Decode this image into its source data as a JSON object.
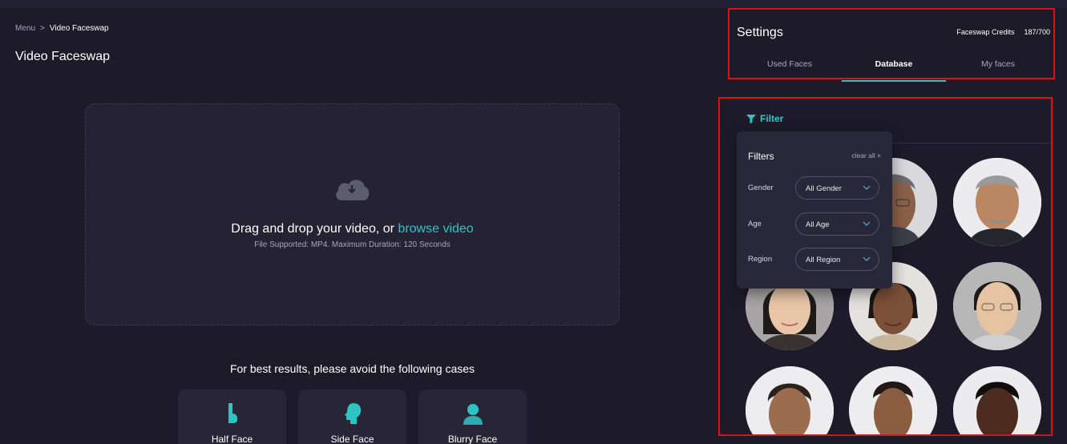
{
  "breadcrumb": {
    "root": "Menu",
    "separator": ">",
    "current": "Video Faceswap"
  },
  "page_title": "Video Faceswap",
  "upload": {
    "text_prefix": "Drag and drop your video, or ",
    "link_text": "browse video",
    "sub_text": "File Supported: MP4. Maximum Duration: 120 Seconds"
  },
  "avoid": {
    "title": "For best results, please avoid the following cases",
    "cases": [
      {
        "label": "Half Face",
        "icon": "half-face-icon"
      },
      {
        "label": "Side Face",
        "icon": "side-face-icon"
      },
      {
        "label": "Blurry Face",
        "icon": "blurry-face-icon"
      }
    ]
  },
  "settings": {
    "title": "Settings",
    "credits_label": "Faceswap Credits",
    "credits_value": "187/700",
    "tabs": [
      "Used Faces",
      "Database",
      "My faces"
    ],
    "active_tab": "Database"
  },
  "filter": {
    "button_label": "Filter",
    "popup_title": "Filters",
    "clear_label": "clear all ×",
    "rows": [
      {
        "label": "Gender",
        "value": "All Gender"
      },
      {
        "label": "Age",
        "value": "All Age"
      },
      {
        "label": "Region",
        "value": "All Region"
      }
    ]
  },
  "colors": {
    "accent": "#2dc4c4",
    "background": "#1d1b2a",
    "panel": "#29283a",
    "highlight_box": "#e01010"
  }
}
